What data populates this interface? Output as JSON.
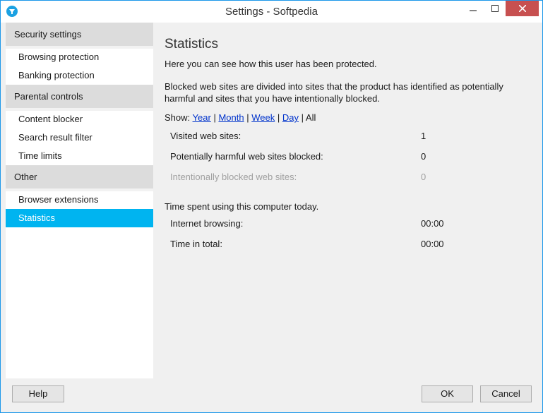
{
  "window": {
    "title": "Settings - Softpedia"
  },
  "sidebar": {
    "groups": [
      {
        "label": "Security settings",
        "items": [
          "Browsing protection",
          "Banking protection"
        ]
      },
      {
        "label": "Parental controls",
        "items": [
          "Content blocker",
          "Search result filter",
          "Time limits"
        ]
      },
      {
        "label": "Other",
        "items": [
          "Browser extensions",
          "Statistics"
        ]
      }
    ],
    "active_item": "Statistics"
  },
  "content": {
    "title": "Statistics",
    "intro": "Here you can see how this user has been protected.",
    "description": "Blocked web sites are divided into sites that the product has identified as potentially harmful and sites that you have intentionally blocked.",
    "show_label": "Show:",
    "filters": [
      "Year",
      "Month",
      "Week",
      "Day",
      "All"
    ],
    "filter_separator": "|",
    "sites": [
      {
        "label": "Visited web sites:",
        "value": "1"
      },
      {
        "label": "Potentially harmful web sites blocked:",
        "value": "0"
      },
      {
        "label": "Intentionally blocked web sites:",
        "value": "0"
      }
    ],
    "time_heading": "Time spent using this computer today.",
    "times": [
      {
        "label": "Internet browsing:",
        "value": "00:00"
      },
      {
        "label": "Time in total:",
        "value": "00:00"
      }
    ]
  },
  "footer": {
    "help_label": "Help",
    "ok_label": "OK",
    "cancel_label": "Cancel"
  },
  "colors": {
    "accent": "#00b4f0",
    "link": "#0033cc",
    "close_button": "#c75050"
  }
}
